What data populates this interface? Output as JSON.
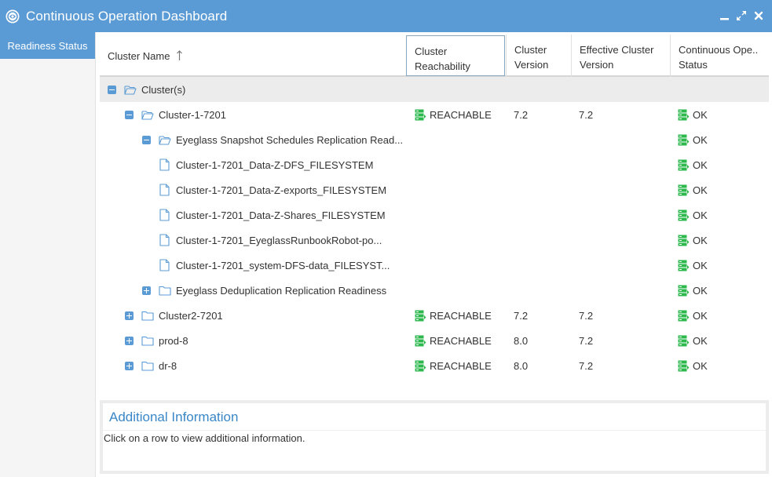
{
  "window": {
    "title": "Continuous Operation Dashboard",
    "accent_color": "#5b9bd5",
    "app_icon": "eyeglass-logo-icon",
    "controls": [
      "minimize-icon",
      "maximize-icon",
      "close-icon"
    ]
  },
  "sidebar": {
    "items": [
      {
        "label": "Readiness Status",
        "active": true
      }
    ]
  },
  "grid": {
    "columns": {
      "name": "Cluster Name",
      "reachability": "Cluster Reachability",
      "version": "Cluster Version",
      "effective_version": "Effective Cluster Version",
      "status": "Continuous Ope.. Status"
    },
    "sort_icon": "sort-ascending-arrow-icon",
    "rows": [
      {
        "name": "Cluster(s)",
        "reach": "",
        "version": "",
        "eff": "",
        "status": ""
      },
      {
        "name": "Cluster-1-7201",
        "reach": "REACHABLE",
        "version": "7.2",
        "eff": "7.2",
        "status": "OK"
      },
      {
        "name": "Eyeglass Snapshot Schedules Replication Read...",
        "reach": "",
        "version": "",
        "eff": "",
        "status": "OK"
      },
      {
        "name": "Cluster-1-7201_Data-Z-DFS_FILESYSTEM",
        "reach": "",
        "version": "",
        "eff": "",
        "status": "OK"
      },
      {
        "name": "Cluster-1-7201_Data-Z-exports_FILESYSTEM",
        "reach": "",
        "version": "",
        "eff": "",
        "status": "OK"
      },
      {
        "name": "Cluster-1-7201_Data-Z-Shares_FILESYSTEM",
        "reach": "",
        "version": "",
        "eff": "",
        "status": "OK"
      },
      {
        "name": "Cluster-1-7201_EyeglassRunbookRobot-po...",
        "reach": "",
        "version": "",
        "eff": "",
        "status": "OK"
      },
      {
        "name": "Cluster-1-7201_system-DFS-data_FILESYST...",
        "reach": "",
        "version": "",
        "eff": "",
        "status": "OK"
      },
      {
        "name": "Eyeglass Deduplication Replication Readiness",
        "reach": "",
        "version": "",
        "eff": "",
        "status": "OK"
      },
      {
        "name": "Cluster2-7201",
        "reach": "REACHABLE",
        "version": "7.2",
        "eff": "7.2",
        "status": "OK"
      },
      {
        "name": "prod-8",
        "reach": "REACHABLE",
        "version": "8.0",
        "eff": "7.2",
        "status": "OK"
      },
      {
        "name": "dr-8",
        "reach": "REACHABLE",
        "version": "8.0",
        "eff": "7.2",
        "status": "OK"
      }
    ]
  },
  "additional_info": {
    "title": "Additional Information",
    "message": "Click on a row to view additional information."
  },
  "colors": {
    "status_green": "#2db84d",
    "header_blue": "#5b9bd5",
    "link_blue": "#3a87c8",
    "row_shade": "#ececec"
  }
}
